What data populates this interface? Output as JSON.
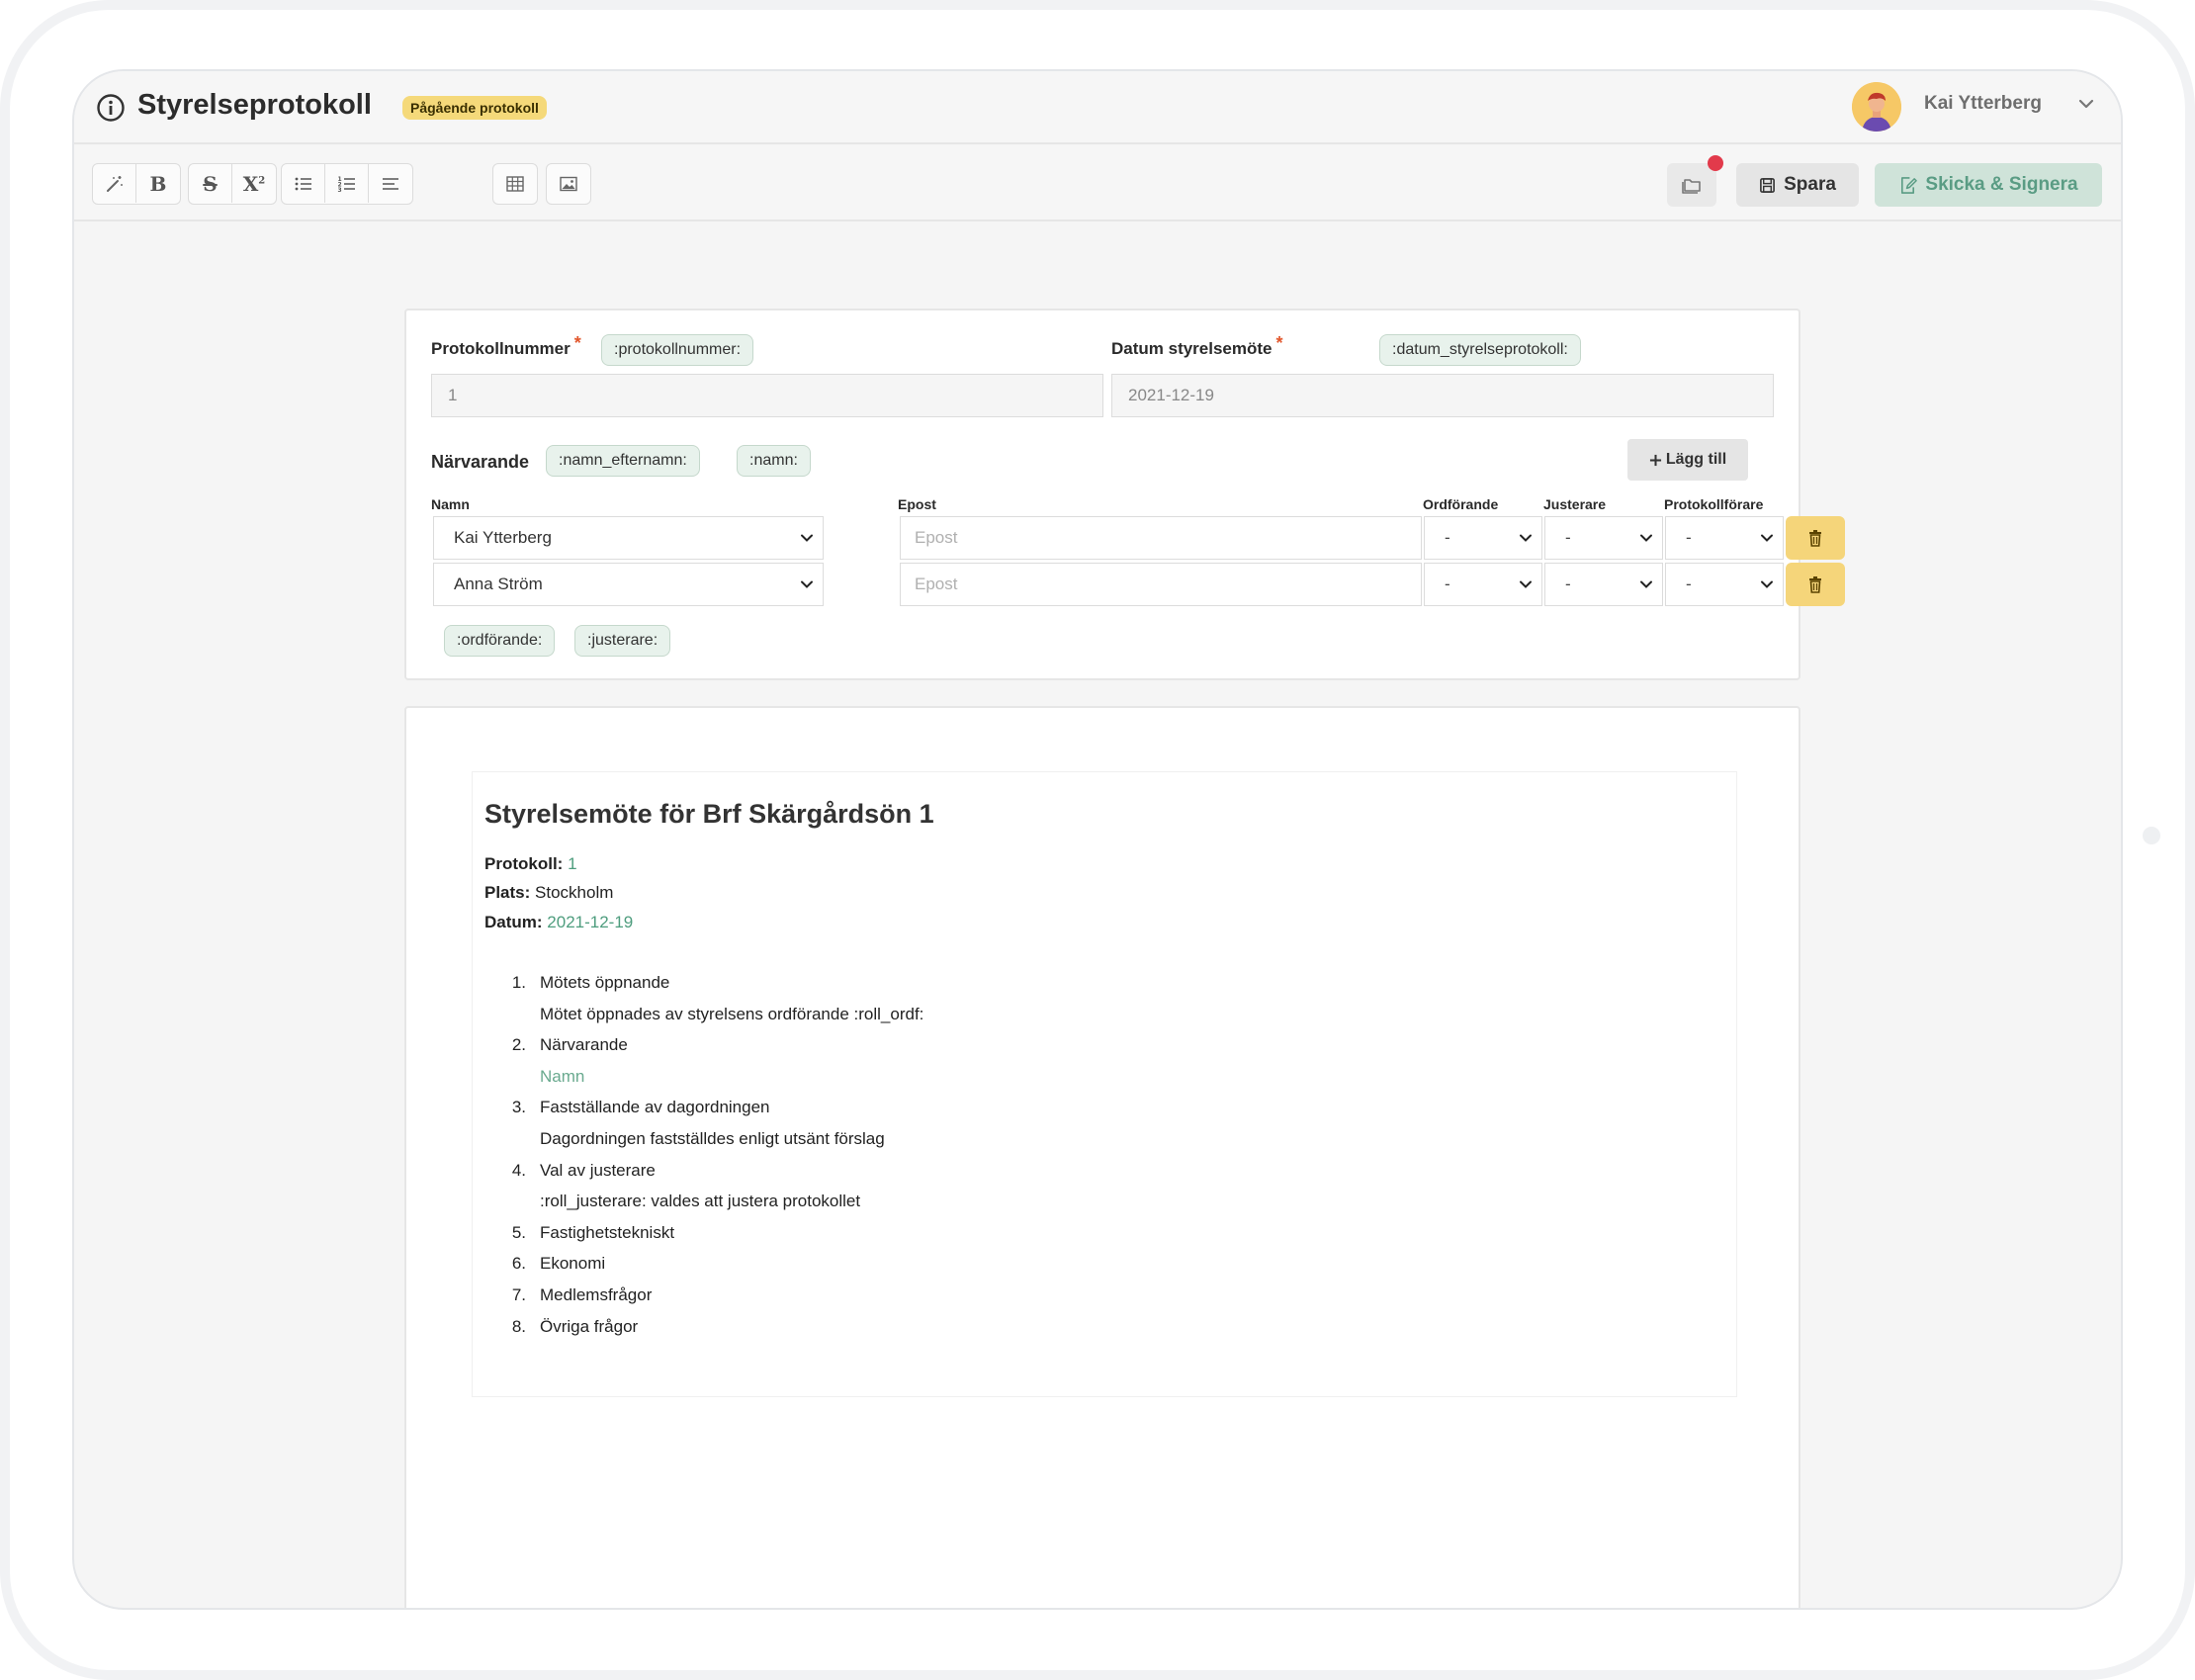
{
  "header": {
    "title": "Styrelseprotokoll",
    "status_badge": "Pågående protokoll",
    "user_name": "Kai Ytterberg"
  },
  "toolbar": {
    "save_label": "Spara",
    "send_sign_label": "Skicka & Signera",
    "tools": [
      "magic-wand",
      "bold",
      "strikethrough",
      "superscript",
      "bullet-list",
      "numbered-list",
      "align",
      "table",
      "image"
    ]
  },
  "form": {
    "protocol_number_label": "Protokollnummer",
    "protocol_number_tag": ":protokollnummer:",
    "protocol_number_value": "1",
    "meeting_date_label": "Datum styrelsemöte",
    "meeting_date_tag": ":datum_styrelseprotokoll:",
    "meeting_date_value": "2021-12-19",
    "required_mark": "*",
    "attendees_label": "Närvarande",
    "attendees_tags": [
      ":namn_efternamn:",
      ":namn:"
    ],
    "add_button": "Lägg till",
    "columns": [
      "Namn",
      "Epost",
      "Ordförande",
      "Justerare",
      "Protokollförare"
    ],
    "rows": [
      {
        "name": "Kai Ytterberg",
        "email_placeholder": "Epost",
        "chair": "-",
        "adjuster": "-",
        "secretary": "-"
      },
      {
        "name": "Anna Ström",
        "email_placeholder": "Epost",
        "chair": "-",
        "adjuster": "-",
        "secretary": "-"
      }
    ],
    "role_tags": [
      ":ordförande:",
      ":justerare:"
    ]
  },
  "document": {
    "title": "Styrelsemöte för Brf Skärgårdsön 1",
    "protocol_label": "Protokoll:",
    "protocol_value": "1",
    "place_label": "Plats:",
    "place_value": "Stockholm",
    "date_label": "Datum:",
    "date_value": "2021-12-19",
    "agenda": [
      {
        "num": "1.",
        "text": "Mötets öppnande"
      },
      {
        "num": "",
        "text": "Mötet öppnades av styrelsens ordförande :roll_ordf:"
      },
      {
        "num": "2.",
        "text": "Närvarande"
      },
      {
        "num": "",
        "text": "Namn",
        "accent": true
      },
      {
        "num": "3.",
        "text": "Fastställande av dagordningen"
      },
      {
        "num": "",
        "text": "Dagordningen fastställdes enligt utsänt förslag"
      },
      {
        "num": "4.",
        "text": "Val av justerare"
      },
      {
        "num": "",
        "text": ":roll_justerare: valdes att justera protokollet"
      },
      {
        "num": "5.",
        "text": "Fastighetstekniskt"
      },
      {
        "num": "6.",
        "text": "Ekonomi"
      },
      {
        "num": "7.",
        "text": "Medlemsfrågor"
      },
      {
        "num": "8.",
        "text": "Övriga frågor"
      }
    ]
  },
  "colors": {
    "accent_green": "#4e9d7e",
    "badge_yellow": "#f5d97a",
    "trash_yellow": "#f5d57a",
    "notification_red": "#e23a4b"
  }
}
